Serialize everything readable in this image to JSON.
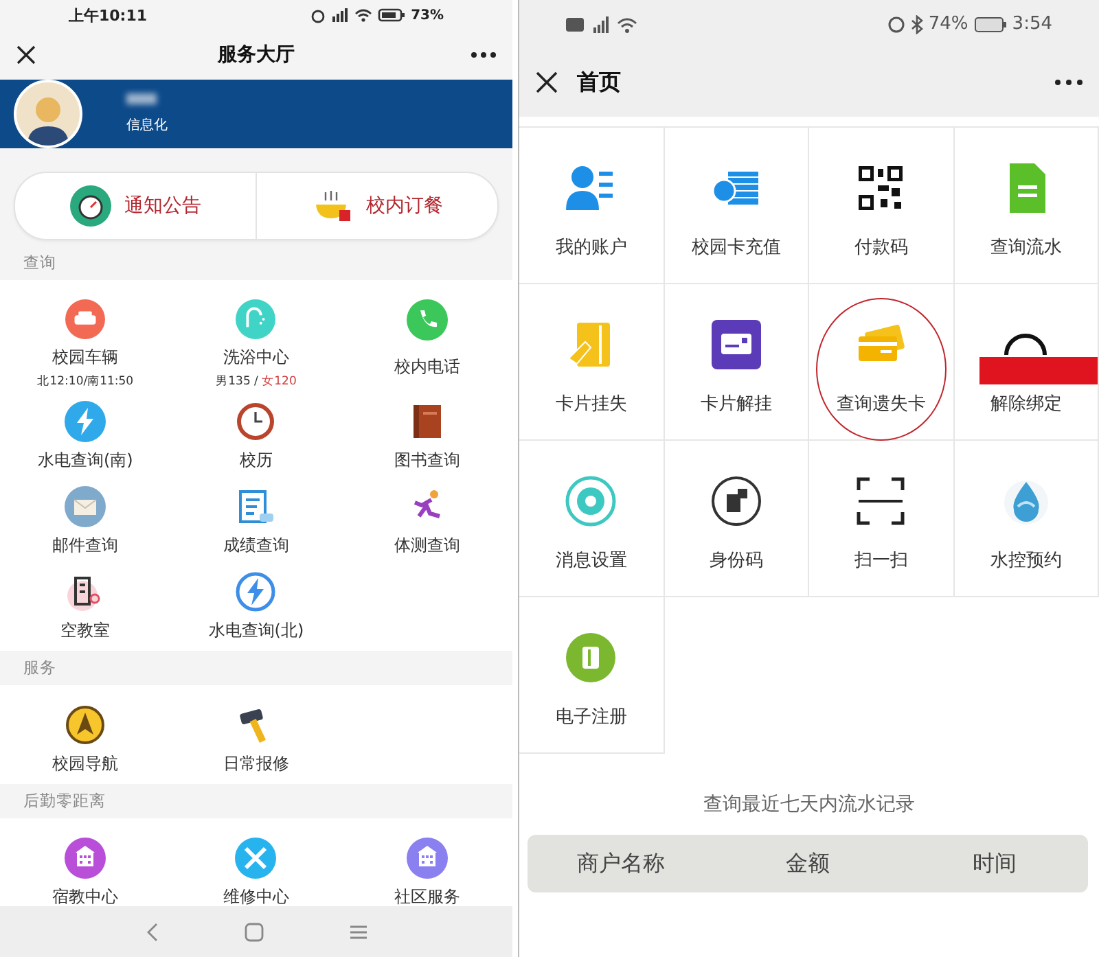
{
  "left_screen": {
    "status_bar": {
      "time": "上午10:11",
      "battery": "73%"
    },
    "title": "服务大厅",
    "profile": {
      "department": "信息化"
    },
    "quick_links": [
      {
        "label": "通知公告"
      },
      {
        "label": "校内订餐"
      }
    ],
    "sections": [
      {
        "title": "查询",
        "items": [
          {
            "label": "校园车辆",
            "sub": [
              {
                "text": "北12:10/南11:50",
                "highlight": false
              }
            ]
          },
          {
            "label": "洗浴中心",
            "sub": [
              {
                "text": "男135 / ",
                "highlight": false
              },
              {
                "text": "女120",
                "highlight": true
              }
            ]
          },
          {
            "label": "校内电话"
          },
          {
            "label": "水电查询(南)"
          },
          {
            "label": "校历"
          },
          {
            "label": "图书查询"
          },
          {
            "label": "邮件查询"
          },
          {
            "label": "成绩查询"
          },
          {
            "label": "体测查询"
          },
          {
            "label": "空教室"
          },
          {
            "label": "水电查询(北)"
          }
        ]
      },
      {
        "title": "服务",
        "items": [
          {
            "label": "校园导航"
          },
          {
            "label": "日常报修"
          }
        ]
      },
      {
        "title": "后勤零距离",
        "items": [
          {
            "label": "宿教中心"
          },
          {
            "label": "维修中心"
          },
          {
            "label": "社区服务"
          }
        ]
      }
    ]
  },
  "right_screen": {
    "status_bar": {
      "battery": "74%",
      "time": "3:54"
    },
    "title": "首页",
    "grid": [
      {
        "label": "我的账户",
        "circled": false,
        "redacted": false
      },
      {
        "label": "校园卡充值",
        "circled": false,
        "redacted": false
      },
      {
        "label": "付款码",
        "circled": false,
        "redacted": false
      },
      {
        "label": "查询流水",
        "circled": false,
        "redacted": false
      },
      {
        "label": "卡片挂失",
        "circled": false,
        "redacted": false
      },
      {
        "label": "卡片解挂",
        "circled": false,
        "redacted": false
      },
      {
        "label": "查询遗失卡",
        "circled": true,
        "redacted": false
      },
      {
        "label": "解除绑定",
        "circled": false,
        "redacted": true
      },
      {
        "label": "消息设置",
        "circled": false,
        "redacted": false
      },
      {
        "label": "身份码",
        "circled": false,
        "redacted": false
      },
      {
        "label": "扫一扫",
        "circled": false,
        "redacted": false
      },
      {
        "label": "水控预约",
        "circled": false,
        "redacted": false
      },
      {
        "label": "电子注册",
        "circled": false,
        "redacted": false
      }
    ],
    "records_caption": "查询最近七天内流水记录",
    "records_table": {
      "columns": [
        "商户名称",
        "金额",
        "时间"
      ]
    }
  }
}
